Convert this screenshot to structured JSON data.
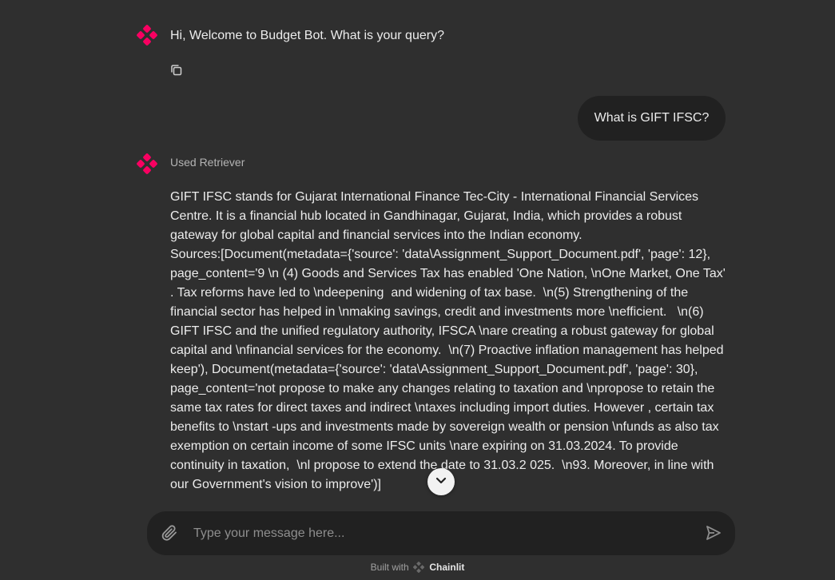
{
  "messages": {
    "bot_greeting": "Hi, Welcome to Budget Bot. What is your query?",
    "user_question": "What is GIFT IFSC?",
    "step_label": "Used Retriever",
    "answer": "GIFT IFSC stands for Gujarat International Finance Tec-City - International Financial Services Centre. It is a financial hub located in Gandhinagar, Gujarat, India, which provides a robust gateway for global capital and financial services into the Indian economy.\nSources:[Document(metadata={'source': 'data\\Assignment_Support_Document.pdf', 'page': 12}, page_content='9 \\n (4) Goods and Services Tax has enabled 'One Nation, \\nOne Market, One Tax' . Tax reforms have led to \\ndeepening  and widening of tax base.  \\n(5) Strengthening of the financial sector has helped in \\nmaking savings, credit and investments more \\nefficient.   \\n(6) GIFT IFSC and the unified regulatory authority, IFSCA \\nare creating a robust gateway for global capital and \\nfinancial services for the economy.  \\n(7) Proactive inflation management has helped keep'), Document(metadata={'source': 'data\\Assignment_Support_Document.pdf', 'page': 30}, page_content='not propose to make any changes relating to taxation and \\npropose to retain the same tax rates for direct taxes and indirect \\ntaxes including import duties. However , certain tax benefits to \\nstart -ups and investments made by sovereign wealth or pension \\nfunds as also tax exemption on certain income of some IFSC units \\nare expiring on 31.03.2024. To provide continuity in taxation,  \\nl propose to extend the date to 31.03.2 025.  \\n93. Moreover, in line with  our Government's vision to improve')]"
  },
  "composer": {
    "placeholder": "Type your message here..."
  },
  "footer": {
    "prefix": "Built with",
    "brand": "Chainlit"
  },
  "icons": {
    "avatar": "chainlit-logo-icon",
    "copy": "copy-icon",
    "scroll": "chevron-down-icon",
    "attach": "paperclip-icon",
    "send": "send-icon"
  },
  "colors": {
    "background": "#2f2f2f",
    "bubble": "#212121",
    "accent": "#f80061"
  }
}
